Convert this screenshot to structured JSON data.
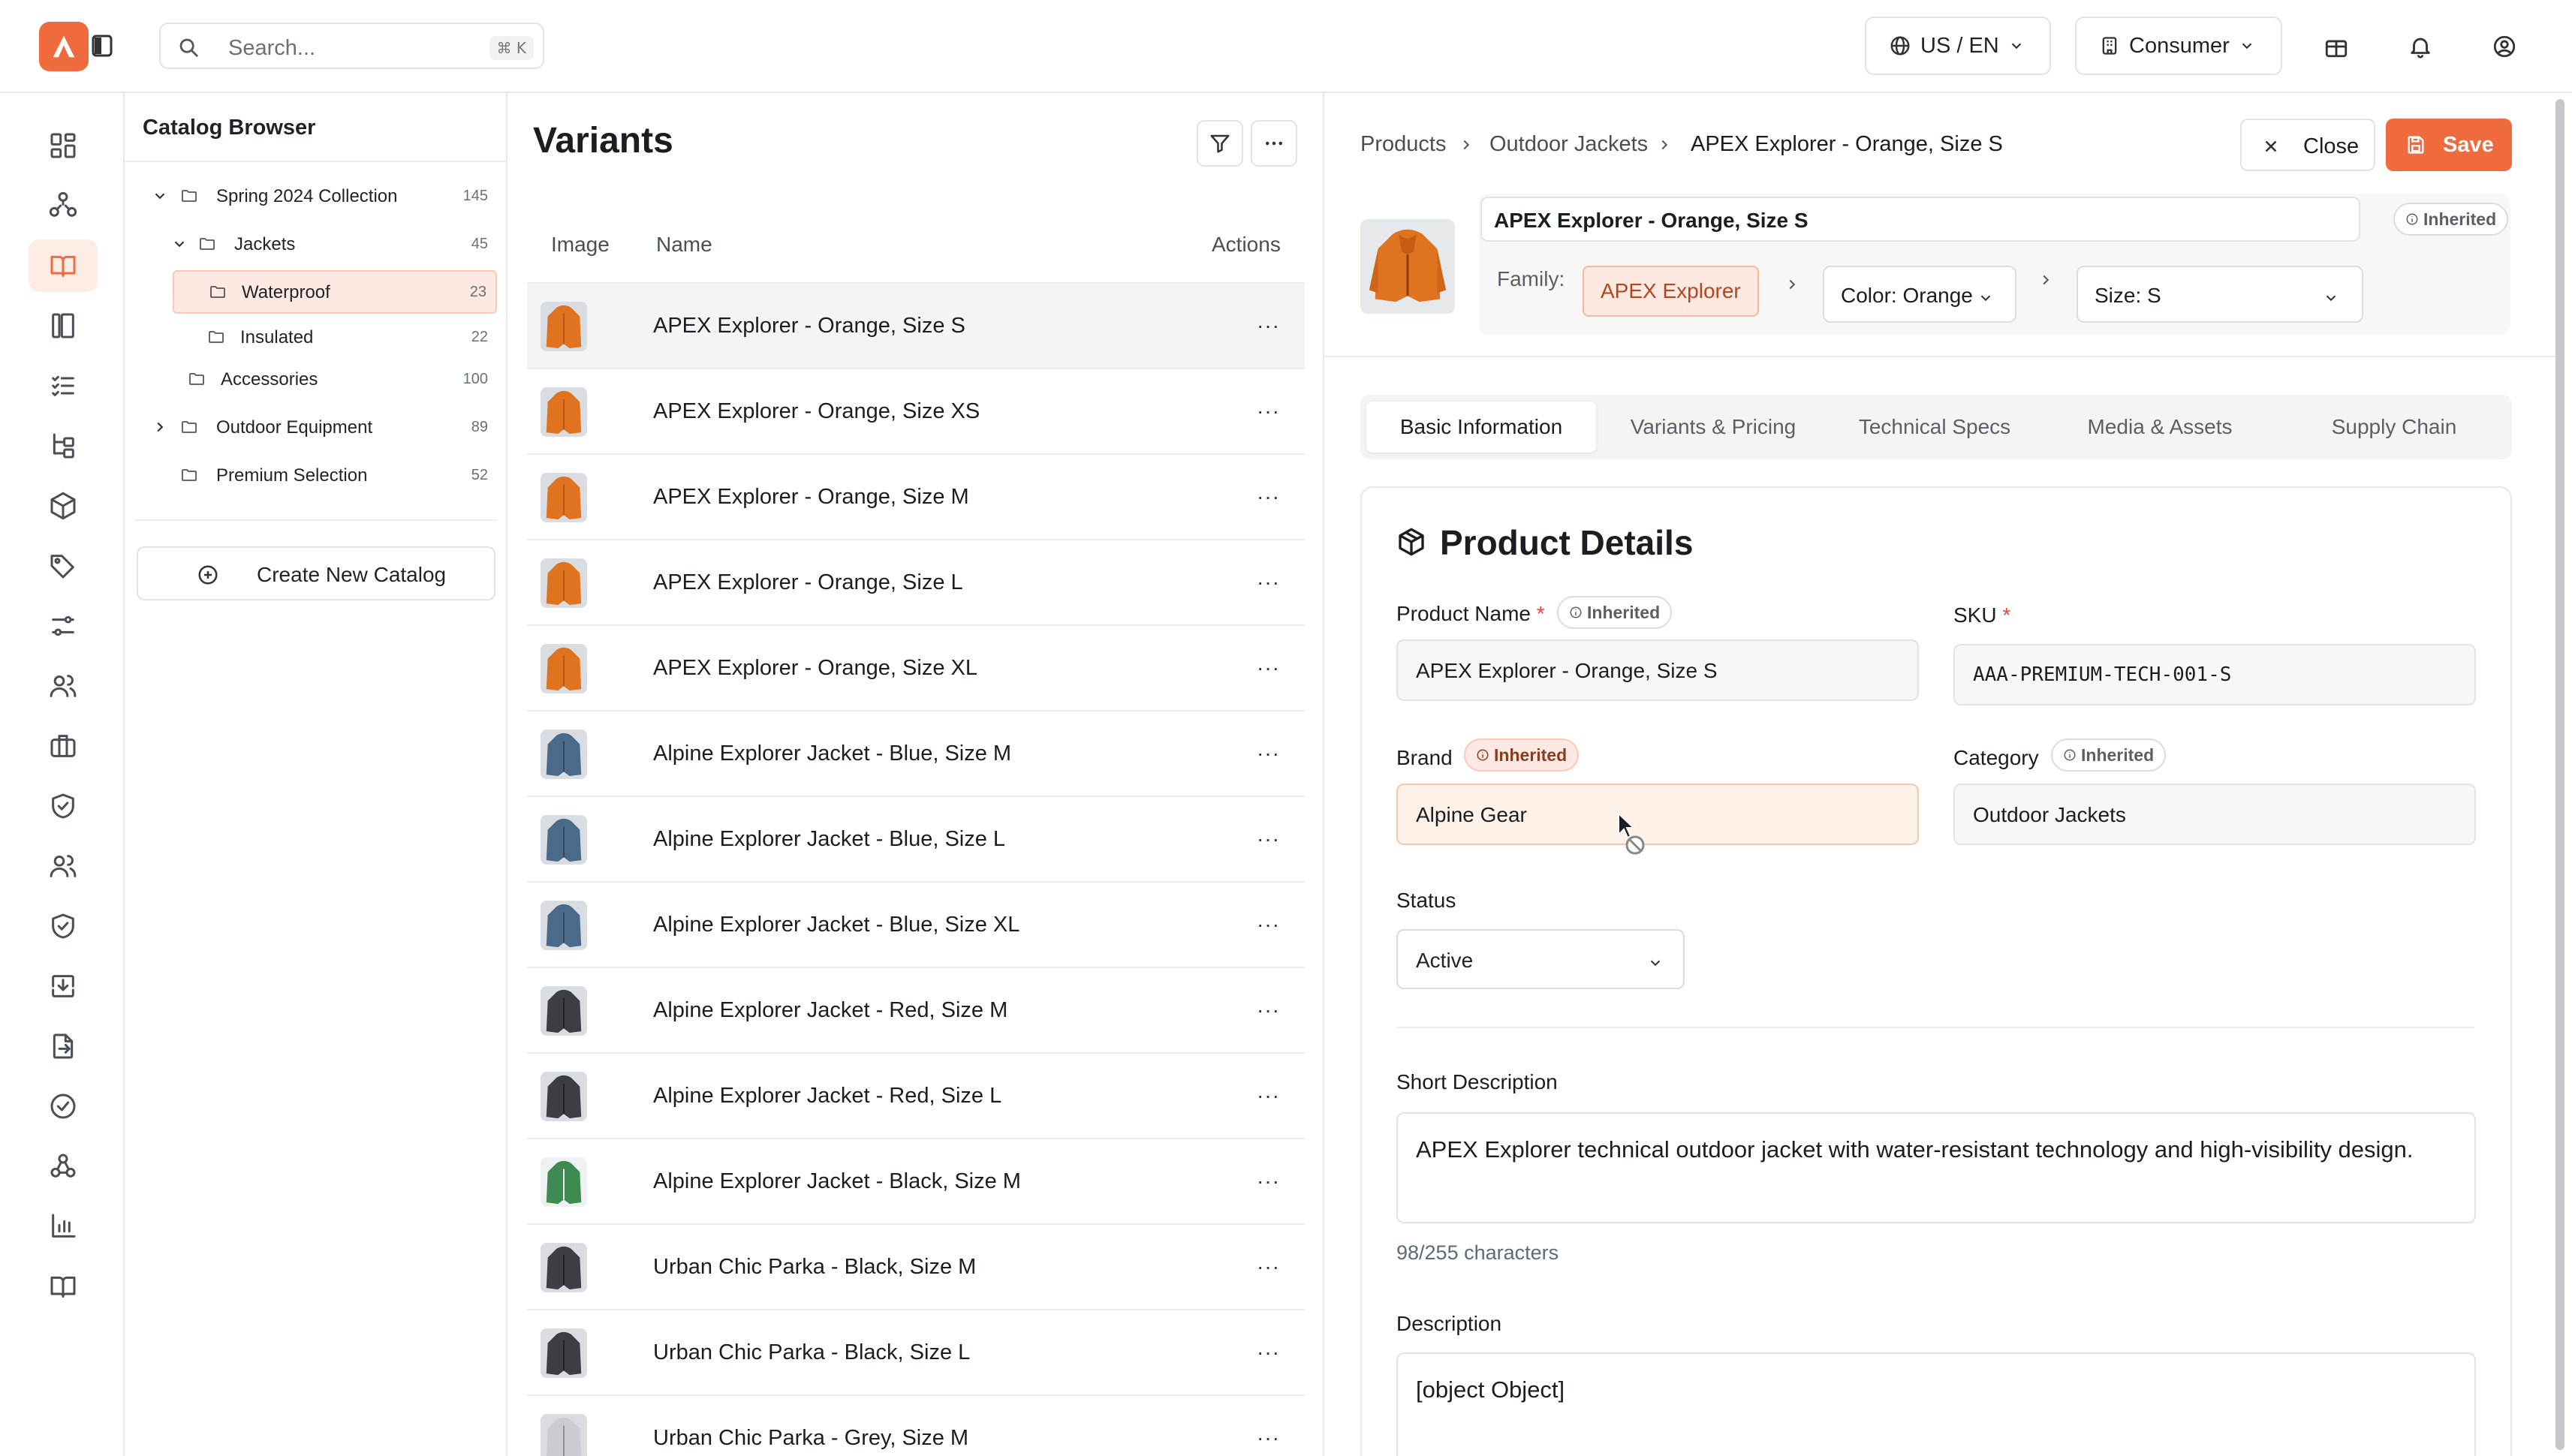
{
  "topbar": {
    "search_placeholder": "Search...",
    "search_shortcut": "⌘ K",
    "locale": "US / EN",
    "audience": "Consumer",
    "icons": [
      "logo-icon",
      "sidebar-toggle-icon",
      "globe-icon",
      "building-icon",
      "gift-icon",
      "bell-icon",
      "user-circle-icon"
    ],
    "brand_color": "#ef6a3c"
  },
  "rail": {
    "active_index": 2,
    "icons": [
      "dashboard-icon",
      "network-icon",
      "catalog-book-icon",
      "library-icon",
      "checklist-icon",
      "hierarchy-icon",
      "cube-icon",
      "tags-icon",
      "sliders-icon",
      "users-icon",
      "briefcase-icon",
      "shield-check-icon",
      "team-icon",
      "shield-check-icon",
      "import-icon",
      "export-icon",
      "check-circle-icon",
      "webhook-icon",
      "analytics-icon",
      "docs-book-icon"
    ]
  },
  "catalog": {
    "title": "Catalog Browser",
    "tree": [
      {
        "label": "Spring 2024 Collection",
        "count": "145",
        "expanded": true
      },
      {
        "label": "Jackets",
        "count": "45",
        "expanded": true
      },
      {
        "label": "Waterproof",
        "count": "23",
        "selected": true
      },
      {
        "label": "Insulated",
        "count": "22"
      },
      {
        "label": "Accessories",
        "count": "100"
      },
      {
        "label": "Outdoor Equipment",
        "count": "89",
        "expanded": false
      },
      {
        "label": "Premium Selection",
        "count": "52"
      }
    ],
    "create_label": "Create New Catalog"
  },
  "variants": {
    "title": "Variants",
    "columns": {
      "image": "Image",
      "name": "Name",
      "actions": "Actions"
    },
    "rows": [
      {
        "name": "APEX Explorer - Orange, Size S",
        "color": "orange",
        "selected": true
      },
      {
        "name": "APEX Explorer - Orange, Size XS",
        "color": "orange"
      },
      {
        "name": "APEX Explorer - Orange, Size M",
        "color": "orange"
      },
      {
        "name": "APEX Explorer - Orange, Size L",
        "color": "orange"
      },
      {
        "name": "APEX Explorer - Orange, Size XL",
        "color": "orange"
      },
      {
        "name": "Alpine Explorer Jacket - Blue, Size M",
        "color": "blue"
      },
      {
        "name": "Alpine Explorer Jacket - Blue, Size L",
        "color": "blue"
      },
      {
        "name": "Alpine Explorer Jacket - Blue, Size XL",
        "color": "blue"
      },
      {
        "name": "Alpine Explorer Jacket - Red, Size M",
        "color": "dark"
      },
      {
        "name": "Alpine Explorer Jacket - Red, Size L",
        "color": "dark"
      },
      {
        "name": "Alpine Explorer Jacket - Black, Size M",
        "color": "green"
      },
      {
        "name": "Urban Chic Parka - Black, Size M",
        "color": "dark"
      },
      {
        "name": "Urban Chic Parka - Black, Size L",
        "color": "dark"
      },
      {
        "name": "Urban Chic Parka - Grey, Size M",
        "color": "grey"
      }
    ],
    "actions_glyph": "···"
  },
  "detail": {
    "breadcrumbs": [
      "Products",
      "Outdoor Jackets",
      "APEX Explorer - Orange, Size S"
    ],
    "close_label": "Close",
    "save_label": "Save",
    "header_name": "APEX Explorer - Orange, Size S",
    "inherited_label": "Inherited",
    "family_label": "Family:",
    "family_value": "APEX Explorer",
    "color_select": "Color: Orange",
    "size_select": "Size: S",
    "tabs": [
      "Basic Information",
      "Variants & Pricing",
      "Technical Specs",
      "Media & Assets",
      "Supply Chain"
    ],
    "active_tab": 0,
    "section_title": "Product Details",
    "fields": {
      "product_name_label": "Product Name",
      "product_name": "APEX Explorer - Orange, Size S",
      "sku_label": "SKU",
      "sku": "AAA-PREMIUM-TECH-001-S",
      "brand_label": "Brand",
      "brand": "Alpine Gear",
      "category_label": "Category",
      "category": "Outdoor Jackets",
      "status_label": "Status",
      "status": "Active",
      "required_mark": "*",
      "short_desc_label": "Short Description",
      "short_desc": "APEX Explorer technical outdoor jacket with water-resistant technology and high-visibility design.",
      "char_count": "98/255 characters",
      "desc_label": "Description",
      "desc": "[object Object]"
    }
  }
}
